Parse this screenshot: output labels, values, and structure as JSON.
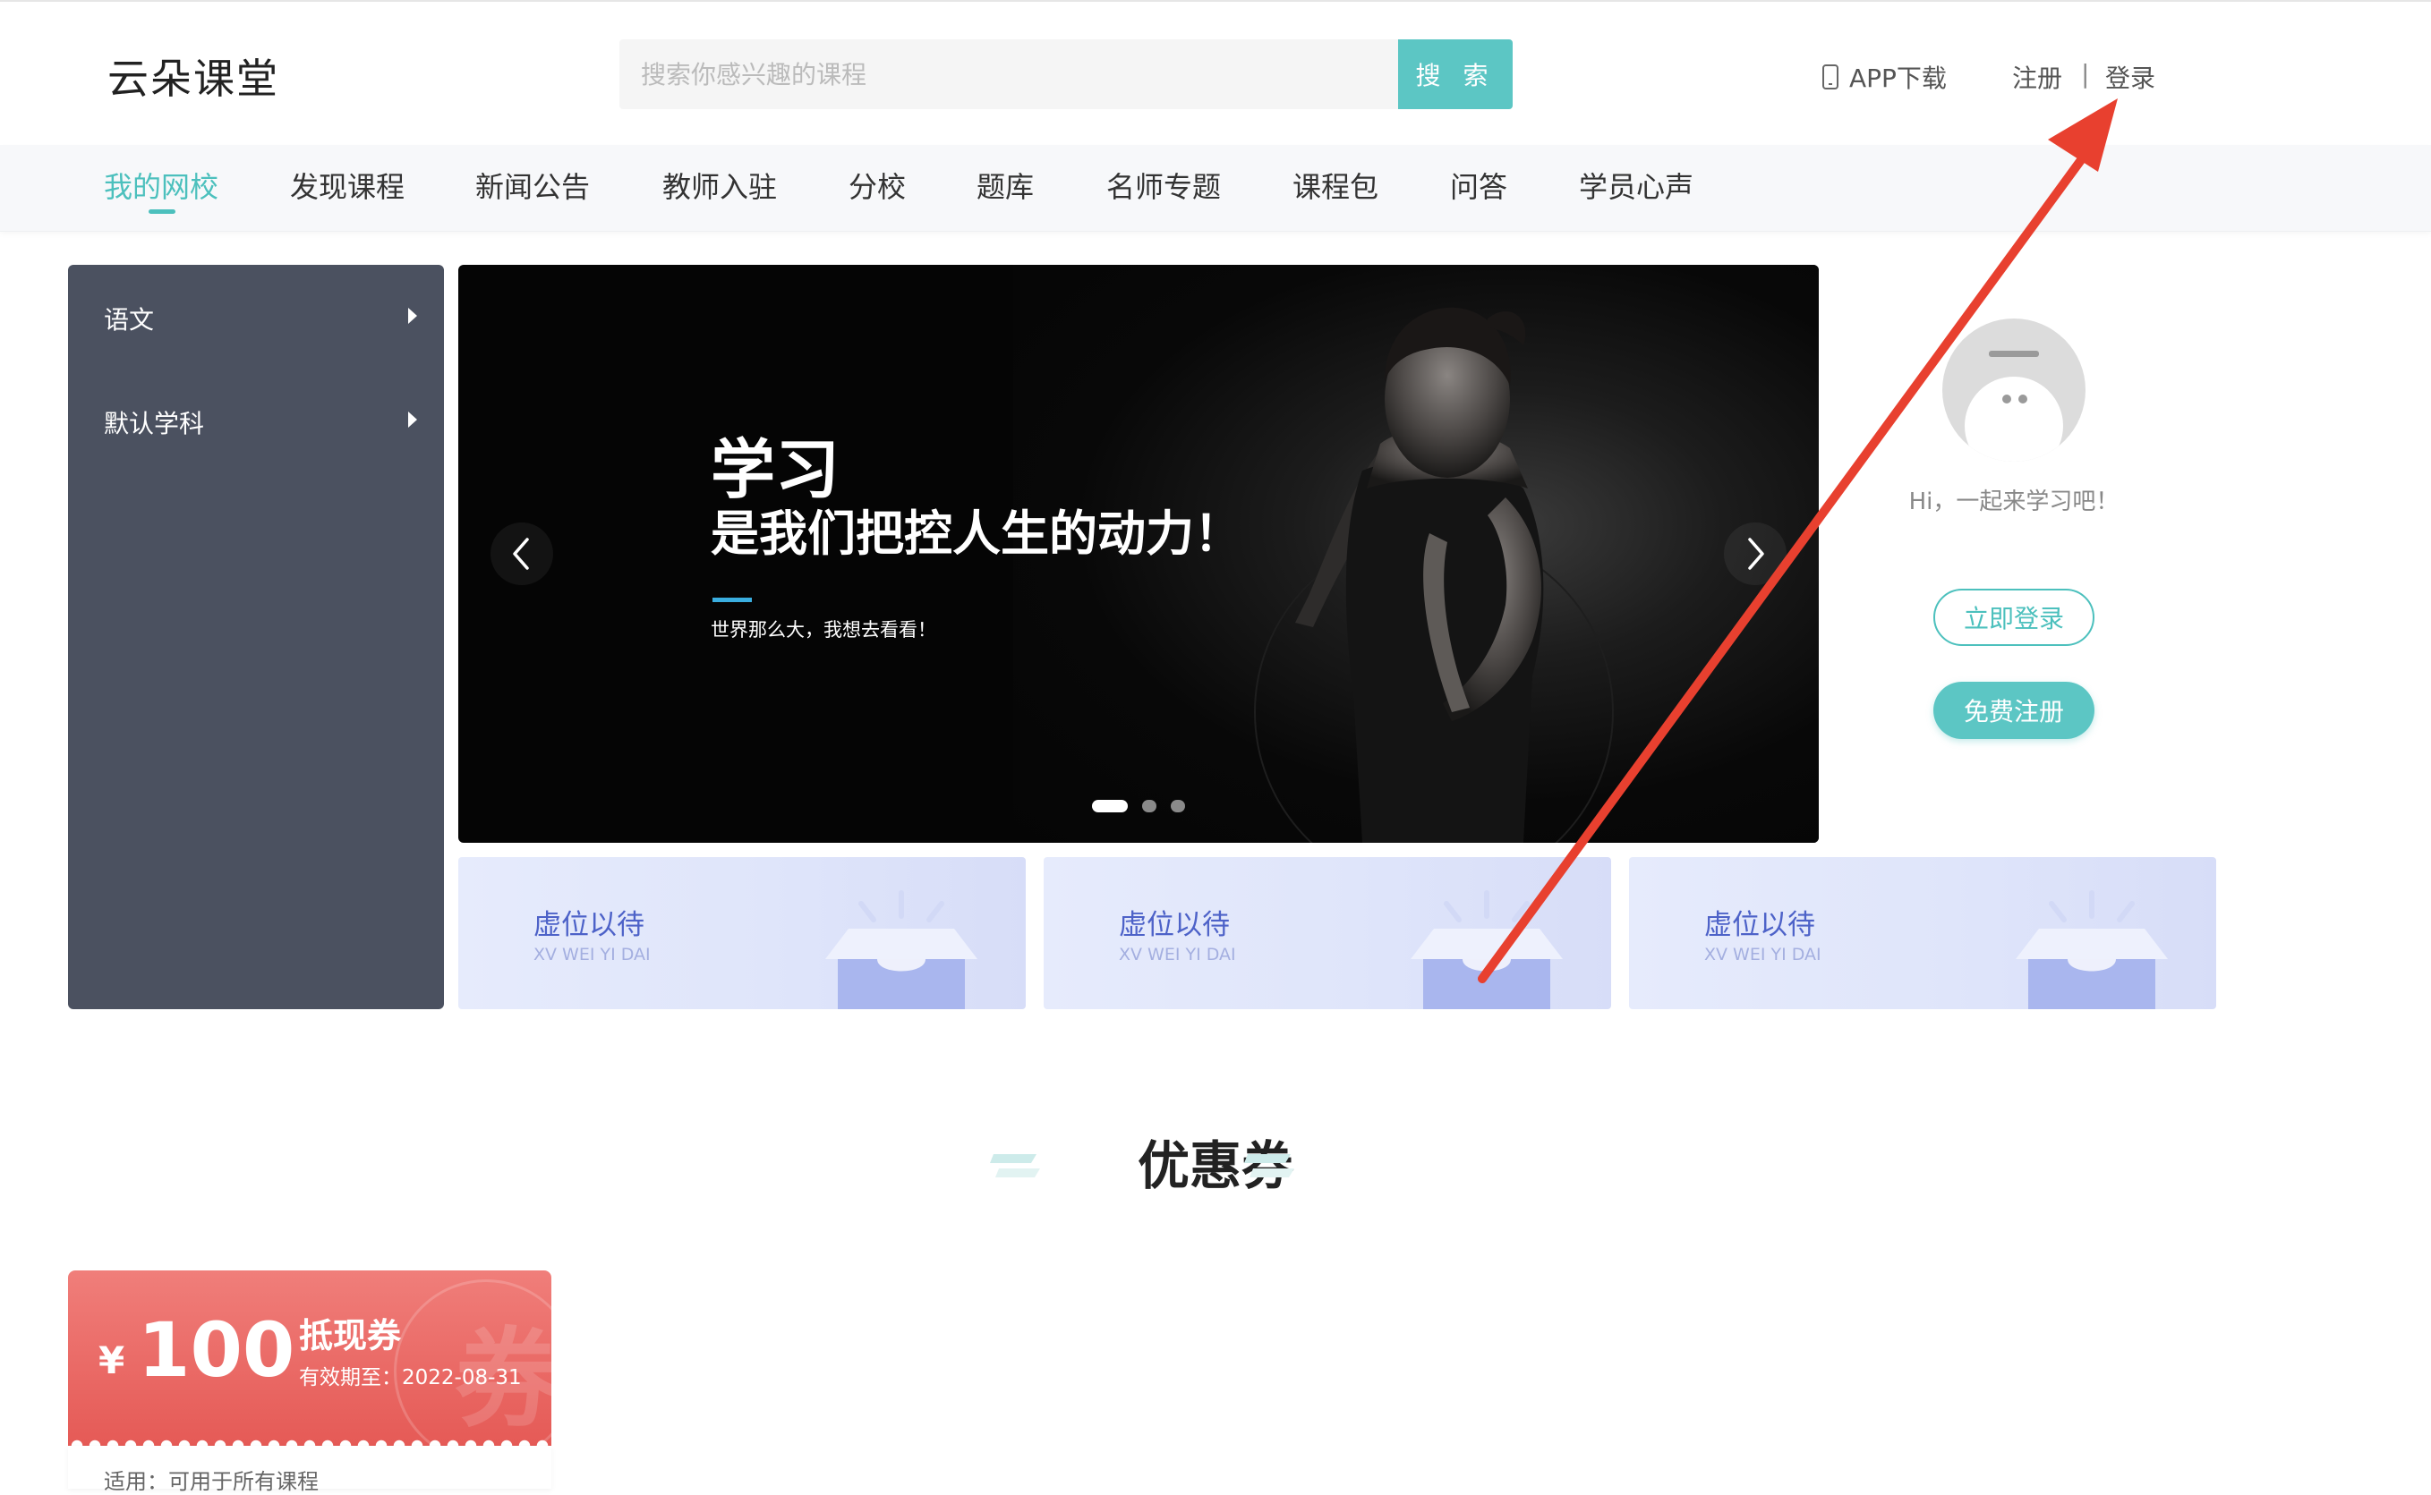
{
  "header": {
    "logo": "云朵课堂",
    "search": {
      "placeholder": "搜索你感兴趣的课程",
      "button_label": "搜 索"
    },
    "app_download": "APP下载",
    "register": "注册",
    "divider": "|",
    "login": "登录"
  },
  "nav": {
    "items": [
      {
        "label": "我的网校",
        "active": true
      },
      {
        "label": "发现课程"
      },
      {
        "label": "新闻公告"
      },
      {
        "label": "教师入驻"
      },
      {
        "label": "分校"
      },
      {
        "label": "题库"
      },
      {
        "label": "名师专题"
      },
      {
        "label": "课程包"
      },
      {
        "label": "问答"
      },
      {
        "label": "学员心声"
      }
    ]
  },
  "sidebar": {
    "items": [
      {
        "label": "语文"
      },
      {
        "label": "默认学科"
      }
    ]
  },
  "banner": {
    "title": "学习",
    "subtitle": "是我们把控人生的动力！",
    "tagline": "世界那么大，我想去看看！",
    "slide_count": 3,
    "active_slide": 1
  },
  "profile": {
    "greeting": "Hi，一起来学习吧！",
    "login_button": "立即登录",
    "register_button": "免费注册"
  },
  "placeholders": [
    {
      "title": "虚位以待",
      "subtitle": "XV WEI YI DAI"
    },
    {
      "title": "虚位以待",
      "subtitle": "XV WEI YI DAI"
    },
    {
      "title": "虚位以待",
      "subtitle": "XV WEI YI DAI"
    }
  ],
  "coupons": {
    "section_title": "优惠券",
    "items": [
      {
        "currency": "¥",
        "amount": "100",
        "type": "抵现券",
        "expiry": "有效期至：2022-08-31",
        "scope": "适用：可用于所有课程",
        "watermark": "券"
      }
    ]
  },
  "colors": {
    "accent": "#4cc0bd",
    "sidebar": "#4b5160",
    "coupon": "#e8605c",
    "placeholder_text": "#4d62c8",
    "annotation_arrow": "#e8402f"
  }
}
